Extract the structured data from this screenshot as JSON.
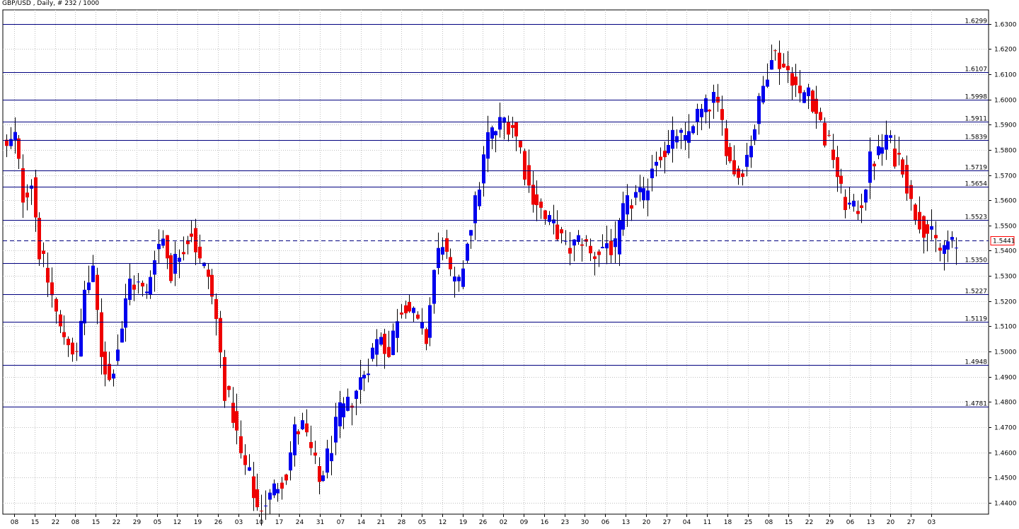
{
  "chart_data": {
    "type": "candlestick",
    "title": "GBP/USD , Daily, # 232 / 1000",
    "ylim": [
      1.4355,
      1.6355
    ],
    "grid": true,
    "colors": {
      "bull": "#0000ee",
      "bear": "#ee0000",
      "wick": "#000000",
      "level": "#00007f",
      "current": "#00007f",
      "current_box": "#ff0000",
      "grid": "#c0c0c0",
      "axis": "#000000"
    },
    "y_ticks": [
      "1.4400",
      "1.4500",
      "1.4600",
      "1.4700",
      "1.4800",
      "1.4900",
      "1.5000",
      "1.5100",
      "1.5200",
      "1.5300",
      "1.5400",
      "1.5500",
      "1.5600",
      "1.5700",
      "1.5800",
      "1.5900",
      "1.6000",
      "1.6100",
      "1.6200",
      "1.6300"
    ],
    "x_ticks": [
      "08",
      "15",
      "22",
      "08",
      "15",
      "22",
      "29",
      "05",
      "12",
      "19",
      "26",
      "03",
      "10",
      "17",
      "24",
      "31",
      "07",
      "14",
      "21",
      "28",
      "05",
      "12",
      "19",
      "26",
      "02",
      "09",
      "16",
      "23",
      "30",
      "06",
      "13",
      "20",
      "27",
      "04",
      "11",
      "18",
      "25",
      "08",
      "15",
      "22",
      "29",
      "06",
      "13",
      "20",
      "27",
      "03"
    ],
    "levels": [
      {
        "label": "1.6299",
        "value": 1.6299
      },
      {
        "label": "1.6107",
        "value": 1.6107
      },
      {
        "label": "1.5998",
        "value": 1.5998
      },
      {
        "label": "1.5911",
        "value": 1.5911
      },
      {
        "label": "1.5839",
        "value": 1.5839
      },
      {
        "label": "1.5719",
        "value": 1.5719
      },
      {
        "label": "1.5654",
        "value": 1.5654
      },
      {
        "label": "1.5523",
        "value": 1.5523
      },
      {
        "label": "1.5350",
        "value": 1.535
      },
      {
        "label": "1.5227",
        "value": 1.5227
      },
      {
        "label": "1.5119",
        "value": 1.5119
      },
      {
        "label": "1.4948",
        "value": 1.4948
      },
      {
        "label": "1.4781",
        "value": 1.4781
      }
    ],
    "current_price": {
      "label": "1.5441",
      "value": 1.5441
    },
    "anchors": [
      [
        "01-08",
        1.58
      ],
      [
        "01-12",
        1.585
      ],
      [
        "01-16",
        1.562
      ],
      [
        "01-22",
        1.568
      ],
      [
        "01-27",
        1.54
      ],
      [
        "01-29",
        1.522
      ],
      [
        "02-02",
        1.508
      ],
      [
        "02-08",
        1.505
      ],
      [
        "02-13",
        1.497
      ],
      [
        "02-18",
        1.525
      ],
      [
        "02-21",
        1.53
      ],
      [
        "02-24",
        1.5
      ],
      [
        "03-01",
        1.488
      ],
      [
        "03-04",
        1.51
      ],
      [
        "03-06",
        1.528
      ],
      [
        "03-08",
        1.526
      ],
      [
        "03-11",
        1.522
      ],
      [
        "03-13",
        1.54
      ],
      [
        "03-17",
        1.545
      ],
      [
        "03-19",
        1.532
      ],
      [
        "03-23",
        1.54
      ],
      [
        "03-26",
        1.548
      ],
      [
        "03-28",
        1.535
      ],
      [
        "03-31",
        1.53
      ],
      [
        "04-04",
        1.512
      ],
      [
        "04-06",
        1.485
      ],
      [
        "04-08",
        1.475
      ],
      [
        "04-11",
        1.458
      ],
      [
        "04-13",
        1.45
      ],
      [
        "04-15",
        1.438
      ],
      [
        "04-18",
        1.442
      ],
      [
        "04-21",
        1.448
      ],
      [
        "04-24",
        1.452
      ],
      [
        "04-27",
        1.468
      ],
      [
        "04-29",
        1.47
      ],
      [
        "05-02",
        1.46
      ],
      [
        "05-06",
        1.448
      ],
      [
        "05-09",
        1.458
      ],
      [
        "05-12",
        1.475
      ],
      [
        "05-17",
        1.478
      ],
      [
        "05-21",
        1.485
      ],
      [
        "05-25",
        1.492
      ],
      [
        "05-28",
        1.5
      ],
      [
        "06-01",
        1.508
      ],
      [
        "06-04",
        1.498
      ],
      [
        "06-07",
        1.515
      ],
      [
        "06-10",
        1.52
      ],
      [
        "06-12",
        1.51
      ],
      [
        "06-15",
        1.505
      ],
      [
        "06-17",
        1.532
      ],
      [
        "06-19",
        1.545
      ],
      [
        "06-22",
        1.528
      ],
      [
        "06-25",
        1.525
      ],
      [
        "06-28",
        1.545
      ],
      [
        "07-01",
        1.558
      ],
      [
        "07-03",
        1.585
      ],
      [
        "07-05",
        1.588
      ],
      [
        "07-07",
        1.592
      ],
      [
        "07-09",
        1.59
      ],
      [
        "07-12",
        1.58
      ],
      [
        "07-14",
        1.565
      ],
      [
        "07-17",
        1.56
      ],
      [
        "07-20",
        1.552
      ],
      [
        "07-23",
        1.548
      ],
      [
        "07-26",
        1.54
      ],
      [
        "07-29",
        1.542
      ],
      [
        "08-02",
        1.545
      ],
      [
        "08-05",
        1.538
      ],
      [
        "08-08",
        1.54
      ],
      [
        "08-10",
        1.543
      ],
      [
        "08-12",
        1.54
      ],
      [
        "08-16",
        1.555
      ],
      [
        "08-19",
        1.562
      ],
      [
        "08-22",
        1.56
      ],
      [
        "08-26",
        1.575
      ],
      [
        "08-29",
        1.58
      ],
      [
        "09-02",
        1.58
      ],
      [
        "09-05",
        1.587
      ],
      [
        "09-08",
        1.582
      ],
      [
        "09-11",
        1.592
      ],
      [
        "09-14",
        1.596
      ],
      [
        "09-17",
        1.6
      ],
      [
        "09-20",
        1.59
      ],
      [
        "09-23",
        1.575
      ],
      [
        "09-26",
        1.57
      ],
      [
        "09-29",
        1.578
      ],
      [
        "10-02",
        1.59
      ],
      [
        "10-05",
        1.605
      ],
      [
        "10-08",
        1.62
      ],
      [
        "10-10",
        1.613
      ],
      [
        "10-13",
        1.61
      ],
      [
        "10-16",
        1.6
      ],
      [
        "10-19",
        1.605
      ],
      [
        "10-22",
        1.595
      ],
      [
        "10-25",
        1.585
      ],
      [
        "10-28",
        1.578
      ],
      [
        "11-01",
        1.562
      ],
      [
        "11-04",
        1.555
      ],
      [
        "11-06",
        1.56
      ],
      [
        "11-10",
        1.575
      ],
      [
        "11-13",
        1.578
      ],
      [
        "11-15",
        1.585
      ],
      [
        "11-18",
        1.578
      ],
      [
        "11-21",
        1.575
      ],
      [
        "11-24",
        1.558
      ],
      [
        "11-26",
        1.55
      ],
      [
        "11-29",
        1.545
      ],
      [
        "12-01",
        1.54
      ],
      [
        "12-03",
        1.543
      ],
      [
        "12-05",
        1.54
      ]
    ]
  }
}
